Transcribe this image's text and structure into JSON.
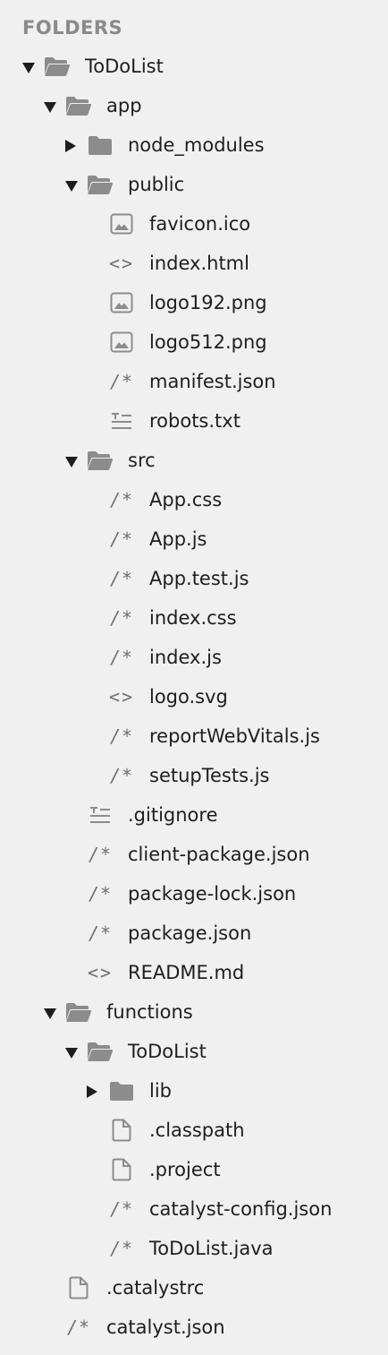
{
  "sidebar": {
    "header": "FOLDERS",
    "items": [
      {
        "label": "ToDoList",
        "depth": 0,
        "kind": "folder",
        "expanded": true,
        "icon": "folder-open-icon"
      },
      {
        "label": "app",
        "depth": 1,
        "kind": "folder",
        "expanded": true,
        "icon": "folder-open-icon"
      },
      {
        "label": "node_modules",
        "depth": 2,
        "kind": "folder",
        "expanded": false,
        "icon": "folder-icon"
      },
      {
        "label": "public",
        "depth": 2,
        "kind": "folder",
        "expanded": true,
        "icon": "folder-open-icon"
      },
      {
        "label": "favicon.ico",
        "depth": 3,
        "kind": "file",
        "icon": "image-file-icon"
      },
      {
        "label": "index.html",
        "depth": 3,
        "kind": "file",
        "icon": "code-file-icon"
      },
      {
        "label": "logo192.png",
        "depth": 3,
        "kind": "file",
        "icon": "image-file-icon"
      },
      {
        "label": "logo512.png",
        "depth": 3,
        "kind": "file",
        "icon": "image-file-icon"
      },
      {
        "label": "manifest.json",
        "depth": 3,
        "kind": "file",
        "icon": "comment-file-icon"
      },
      {
        "label": "robots.txt",
        "depth": 3,
        "kind": "file",
        "icon": "text-file-icon"
      },
      {
        "label": "src",
        "depth": 2,
        "kind": "folder",
        "expanded": true,
        "icon": "folder-open-icon"
      },
      {
        "label": "App.css",
        "depth": 3,
        "kind": "file",
        "icon": "comment-file-icon"
      },
      {
        "label": "App.js",
        "depth": 3,
        "kind": "file",
        "icon": "comment-file-icon"
      },
      {
        "label": "App.test.js",
        "depth": 3,
        "kind": "file",
        "icon": "comment-file-icon"
      },
      {
        "label": "index.css",
        "depth": 3,
        "kind": "file",
        "icon": "comment-file-icon"
      },
      {
        "label": "index.js",
        "depth": 3,
        "kind": "file",
        "icon": "comment-file-icon"
      },
      {
        "label": "logo.svg",
        "depth": 3,
        "kind": "file",
        "icon": "code-file-icon"
      },
      {
        "label": "reportWebVitals.js",
        "depth": 3,
        "kind": "file",
        "icon": "comment-file-icon"
      },
      {
        "label": "setupTests.js",
        "depth": 3,
        "kind": "file",
        "icon": "comment-file-icon"
      },
      {
        "label": ".gitignore",
        "depth": 2,
        "kind": "file",
        "icon": "text-file-icon"
      },
      {
        "label": "client-package.json",
        "depth": 2,
        "kind": "file",
        "icon": "comment-file-icon"
      },
      {
        "label": "package-lock.json",
        "depth": 2,
        "kind": "file",
        "icon": "comment-file-icon"
      },
      {
        "label": "package.json",
        "depth": 2,
        "kind": "file",
        "icon": "comment-file-icon"
      },
      {
        "label": "README.md",
        "depth": 2,
        "kind": "file",
        "icon": "code-file-icon"
      },
      {
        "label": "functions",
        "depth": 1,
        "kind": "folder",
        "expanded": true,
        "icon": "folder-open-icon"
      },
      {
        "label": "ToDoList",
        "depth": 2,
        "kind": "folder",
        "expanded": true,
        "icon": "folder-open-icon"
      },
      {
        "label": "lib",
        "depth": 3,
        "kind": "folder",
        "expanded": false,
        "icon": "folder-icon"
      },
      {
        "label": ".classpath",
        "depth": 3,
        "kind": "file",
        "icon": "blank-file-icon"
      },
      {
        "label": ".project",
        "depth": 3,
        "kind": "file",
        "icon": "blank-file-icon"
      },
      {
        "label": "catalyst-config.json",
        "depth": 3,
        "kind": "file",
        "icon": "comment-file-icon"
      },
      {
        "label": "ToDoList.java",
        "depth": 3,
        "kind": "file",
        "icon": "comment-file-icon"
      },
      {
        "label": ".catalystrc",
        "depth": 1,
        "kind": "file",
        "icon": "blank-file-icon"
      },
      {
        "label": "catalyst.json",
        "depth": 1,
        "kind": "file",
        "icon": "comment-file-icon"
      }
    ]
  },
  "colors": {
    "background": "#f0f0f0",
    "text": "#1e1e1e",
    "header": "#8a8a8a",
    "icon": "#8c8c8c",
    "glyph": "#6f6f6f"
  }
}
